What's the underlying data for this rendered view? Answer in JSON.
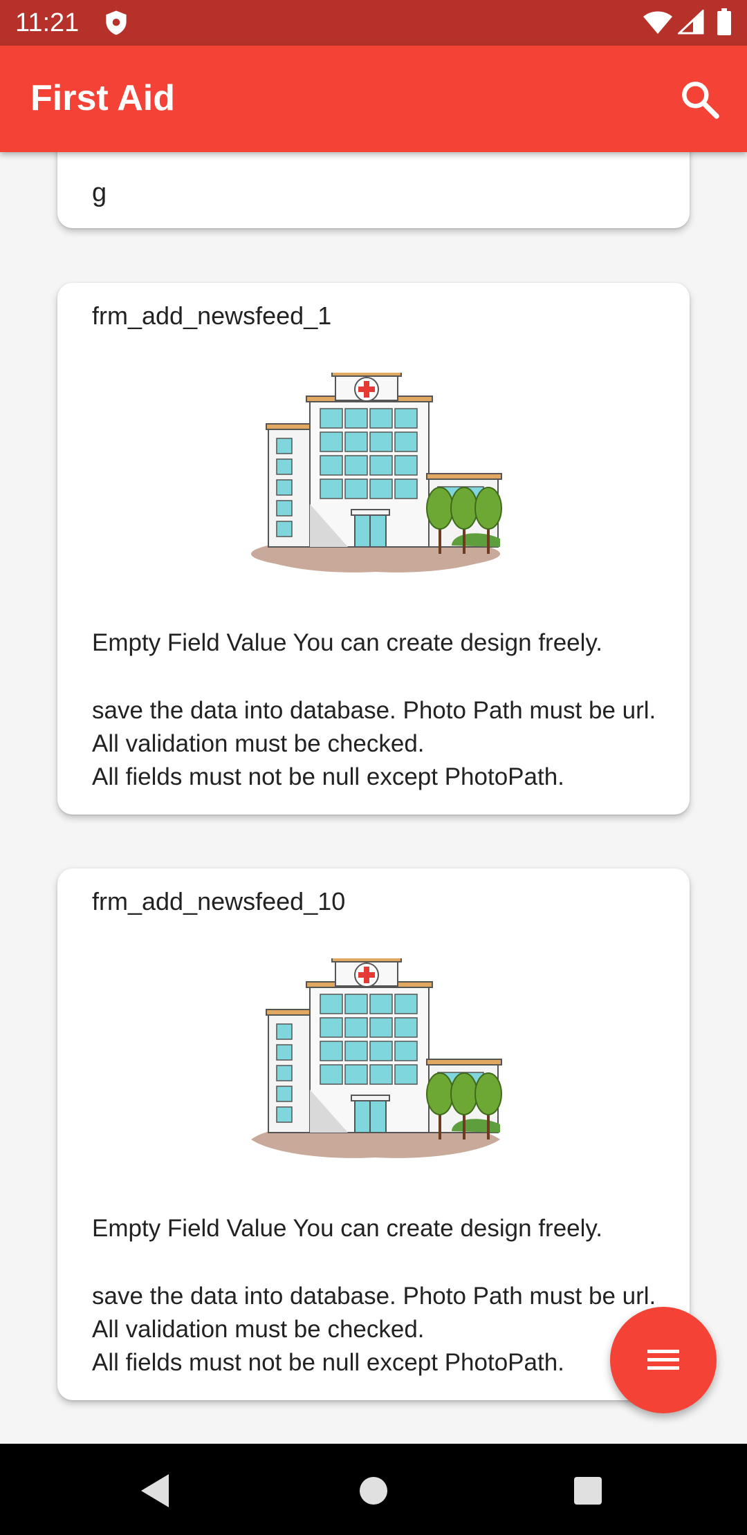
{
  "status_bar": {
    "time": "11:21",
    "icons": [
      "shield-icon",
      "wifi-icon",
      "signal-icon",
      "battery-icon"
    ]
  },
  "app_bar": {
    "title": "First Aid",
    "search_icon": "search-icon",
    "color": "#f44336"
  },
  "feed": {
    "partial_card": {
      "text": "g"
    },
    "cards": [
      {
        "title": "frm_add_newsfeed_1",
        "image": "hospital-illustration",
        "line1": "Empty Field Value You can create design freely.",
        "line2": "save the data into database. Photo Path must be url. All validation must be checked.",
        "line3": "All fields must not be null except PhotoPath."
      },
      {
        "title": "frm_add_newsfeed_10",
        "image": "hospital-illustration",
        "line1": "Empty Field Value You can create design freely.",
        "line2": "save the data into database. Photo Path must be url. All validation must be checked.",
        "line3": "All fields must not be null except PhotoPath."
      }
    ]
  },
  "fab": {
    "icon": "menu-icon",
    "color": "#f44336"
  },
  "nav_bar": {
    "icons": [
      "back-icon",
      "home-icon",
      "recent-apps-icon"
    ]
  }
}
